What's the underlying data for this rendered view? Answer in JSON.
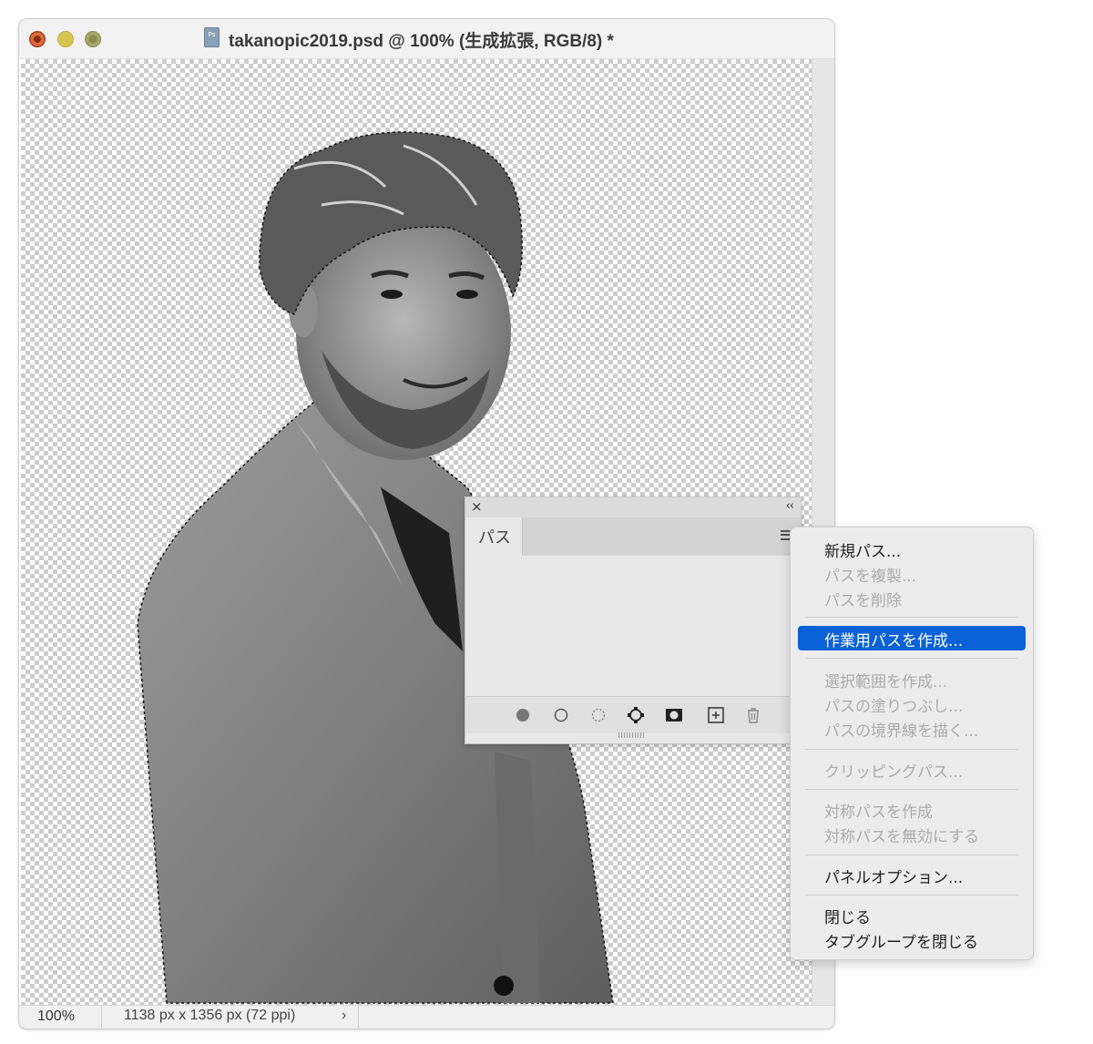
{
  "window": {
    "title": "takanopic2019.psd @ 100% (生成拡張, RGB/8) *",
    "doc_icon_text": "Ps"
  },
  "status_bar": {
    "zoom": "100%",
    "doc_info": "1138 px x 1356 px (72 ppi)",
    "more_glyph": "›"
  },
  "paths_panel": {
    "close_glyph": "×",
    "collapse_glyph": "‹‹",
    "tab_label": "パス",
    "footer_buttons": [
      "fill-path-icon",
      "stroke-path-icon",
      "load-as-selection-icon",
      "make-path-from-selection-icon",
      "add-mask-icon",
      "new-path-icon",
      "delete-path-icon"
    ]
  },
  "context_menu": {
    "items": [
      {
        "label": "新規パス...",
        "enabled": true
      },
      {
        "label": "パスを複製...",
        "enabled": false
      },
      {
        "label": "パスを削除",
        "enabled": false
      },
      {
        "label": "作業用パスを作成...",
        "enabled": true,
        "selected": true
      },
      {
        "label": "選択範囲を作成...",
        "enabled": false
      },
      {
        "label": "パスの塗りつぶし...",
        "enabled": false
      },
      {
        "label": "パスの境界線を描く...",
        "enabled": false
      },
      {
        "label": "クリッピングパス...",
        "enabled": false
      },
      {
        "label": "対称パスを作成",
        "enabled": false
      },
      {
        "label": "対称パスを無効にする",
        "enabled": false
      },
      {
        "label": "パネルオプション...",
        "enabled": true
      },
      {
        "label": "閉じる",
        "enabled": true
      },
      {
        "label": "タブグループを閉じる",
        "enabled": true
      }
    ]
  },
  "colors": {
    "selection_highlight": "#0a61d8",
    "checker": "#cccccc",
    "disabled_text": "#ababab"
  }
}
